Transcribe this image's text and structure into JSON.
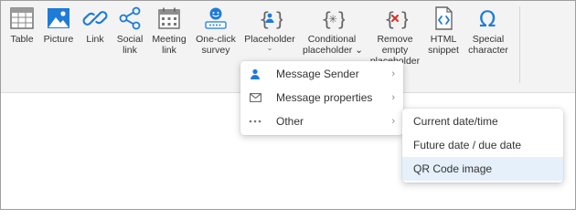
{
  "ribbon": {
    "buttons": [
      {
        "label": "Table",
        "icon": "table-icon"
      },
      {
        "label": "Picture",
        "icon": "picture-icon"
      },
      {
        "label": "Link",
        "icon": "link-icon"
      },
      {
        "label": "Social",
        "label2": "link",
        "icon": "share-icon"
      },
      {
        "label": "Meeting",
        "label2": "link",
        "icon": "calendar-icon"
      },
      {
        "label": "One-click",
        "label2": "survey",
        "icon": "survey-icon"
      },
      {
        "label": "Placeholder",
        "chevron": "⌄",
        "icon": "placeholder-icon"
      },
      {
        "label": "Conditional",
        "label2": "placeholder ⌄",
        "icon": "conditional-placeholder-icon"
      },
      {
        "label": "Remove",
        "label2": "empty",
        "label3": "placeholder",
        "icon": "remove-placeholder-icon"
      },
      {
        "label": "HTML",
        "label2": "snippet",
        "icon": "html-snippet-icon"
      },
      {
        "label": "Special",
        "label2": "character",
        "icon": "omega-icon"
      }
    ]
  },
  "placeholder_menu": {
    "items": [
      {
        "label": "Message Sender",
        "icon": "person-icon",
        "arrow": "›"
      },
      {
        "label": "Message properties",
        "icon": "envelope-icon",
        "arrow": "›"
      },
      {
        "label": "Other",
        "icon": "more-icon",
        "arrow": "›"
      }
    ]
  },
  "other_submenu": {
    "items": [
      {
        "label": "Current date/time",
        "highlighted": false
      },
      {
        "label": "Future date / due date",
        "highlighted": false
      },
      {
        "label": "QR Code image",
        "highlighted": true
      }
    ]
  },
  "colors": {
    "accent_blue": "#1e7bd8",
    "icon_red": "#d93025",
    "ribbon_bg": "#f3f3f3",
    "highlight": "#e5f0fb"
  }
}
